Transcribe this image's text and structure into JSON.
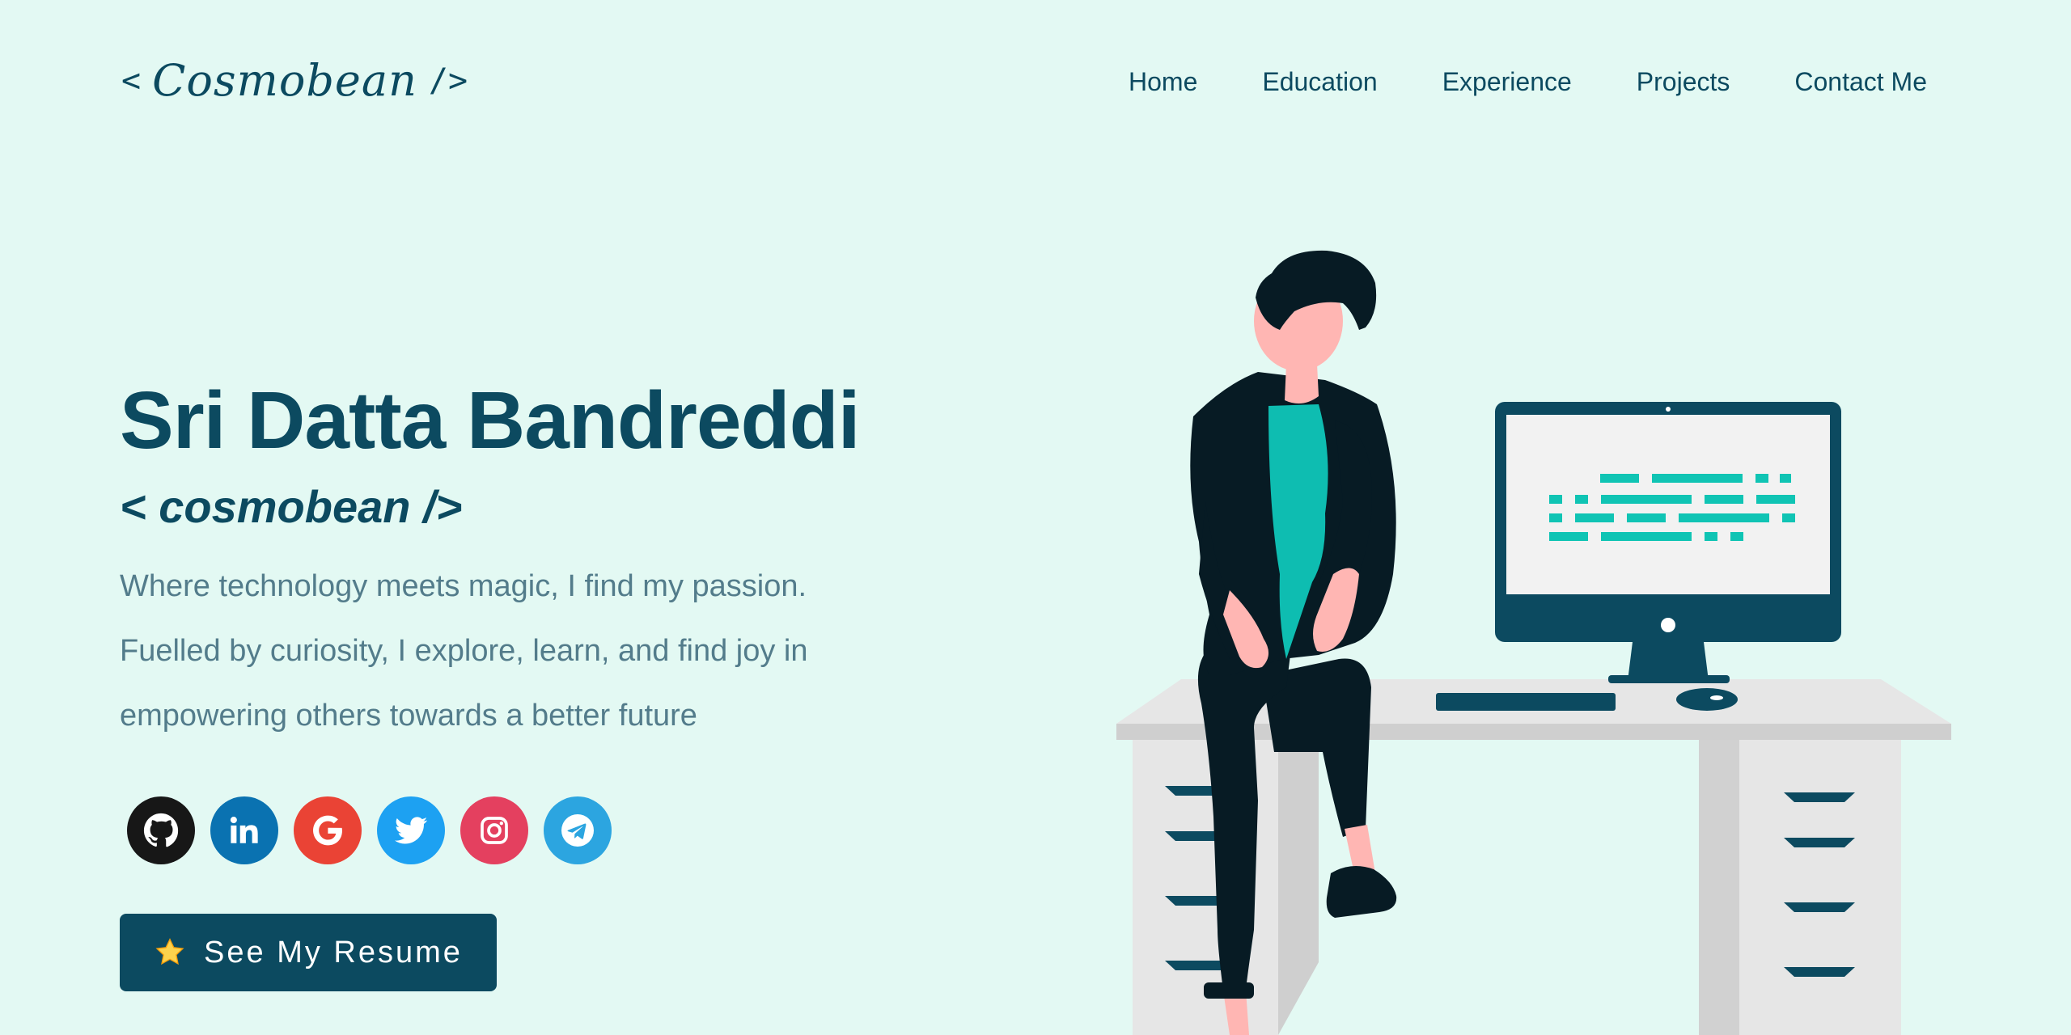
{
  "header": {
    "logo": {
      "open_bracket": "<",
      "script": "Cosmobean",
      "close_bracket": "/>"
    },
    "nav": [
      {
        "label": "Home"
      },
      {
        "label": "Education"
      },
      {
        "label": "Experience"
      },
      {
        "label": "Projects"
      },
      {
        "label": "Contact Me"
      }
    ]
  },
  "hero": {
    "name": "Sri Datta Bandreddi",
    "handle": "< cosmobean />",
    "tagline": "Where technology meets magic, I find my passion. Fuelled by curiosity, I explore, learn, and find joy in empowering others towards a better future"
  },
  "social": [
    {
      "icon": "github-icon",
      "color": "#171717"
    },
    {
      "icon": "linkedin-icon",
      "color": "#0a72b1"
    },
    {
      "icon": "google-icon",
      "color": "#ea4335"
    },
    {
      "icon": "twitter-icon",
      "color": "#1da1f2"
    },
    {
      "icon": "instagram-icon",
      "color": "#e4405f"
    },
    {
      "icon": "telegram-icon",
      "color": "#2ca5e0"
    }
  ],
  "resume_button": {
    "icon": "star-icon",
    "label": "See My Resume"
  },
  "colors": {
    "background": "#e3f9f3",
    "primary": "#0c4a60",
    "tagline": "#537c8b",
    "accent": "#10c4b4"
  }
}
